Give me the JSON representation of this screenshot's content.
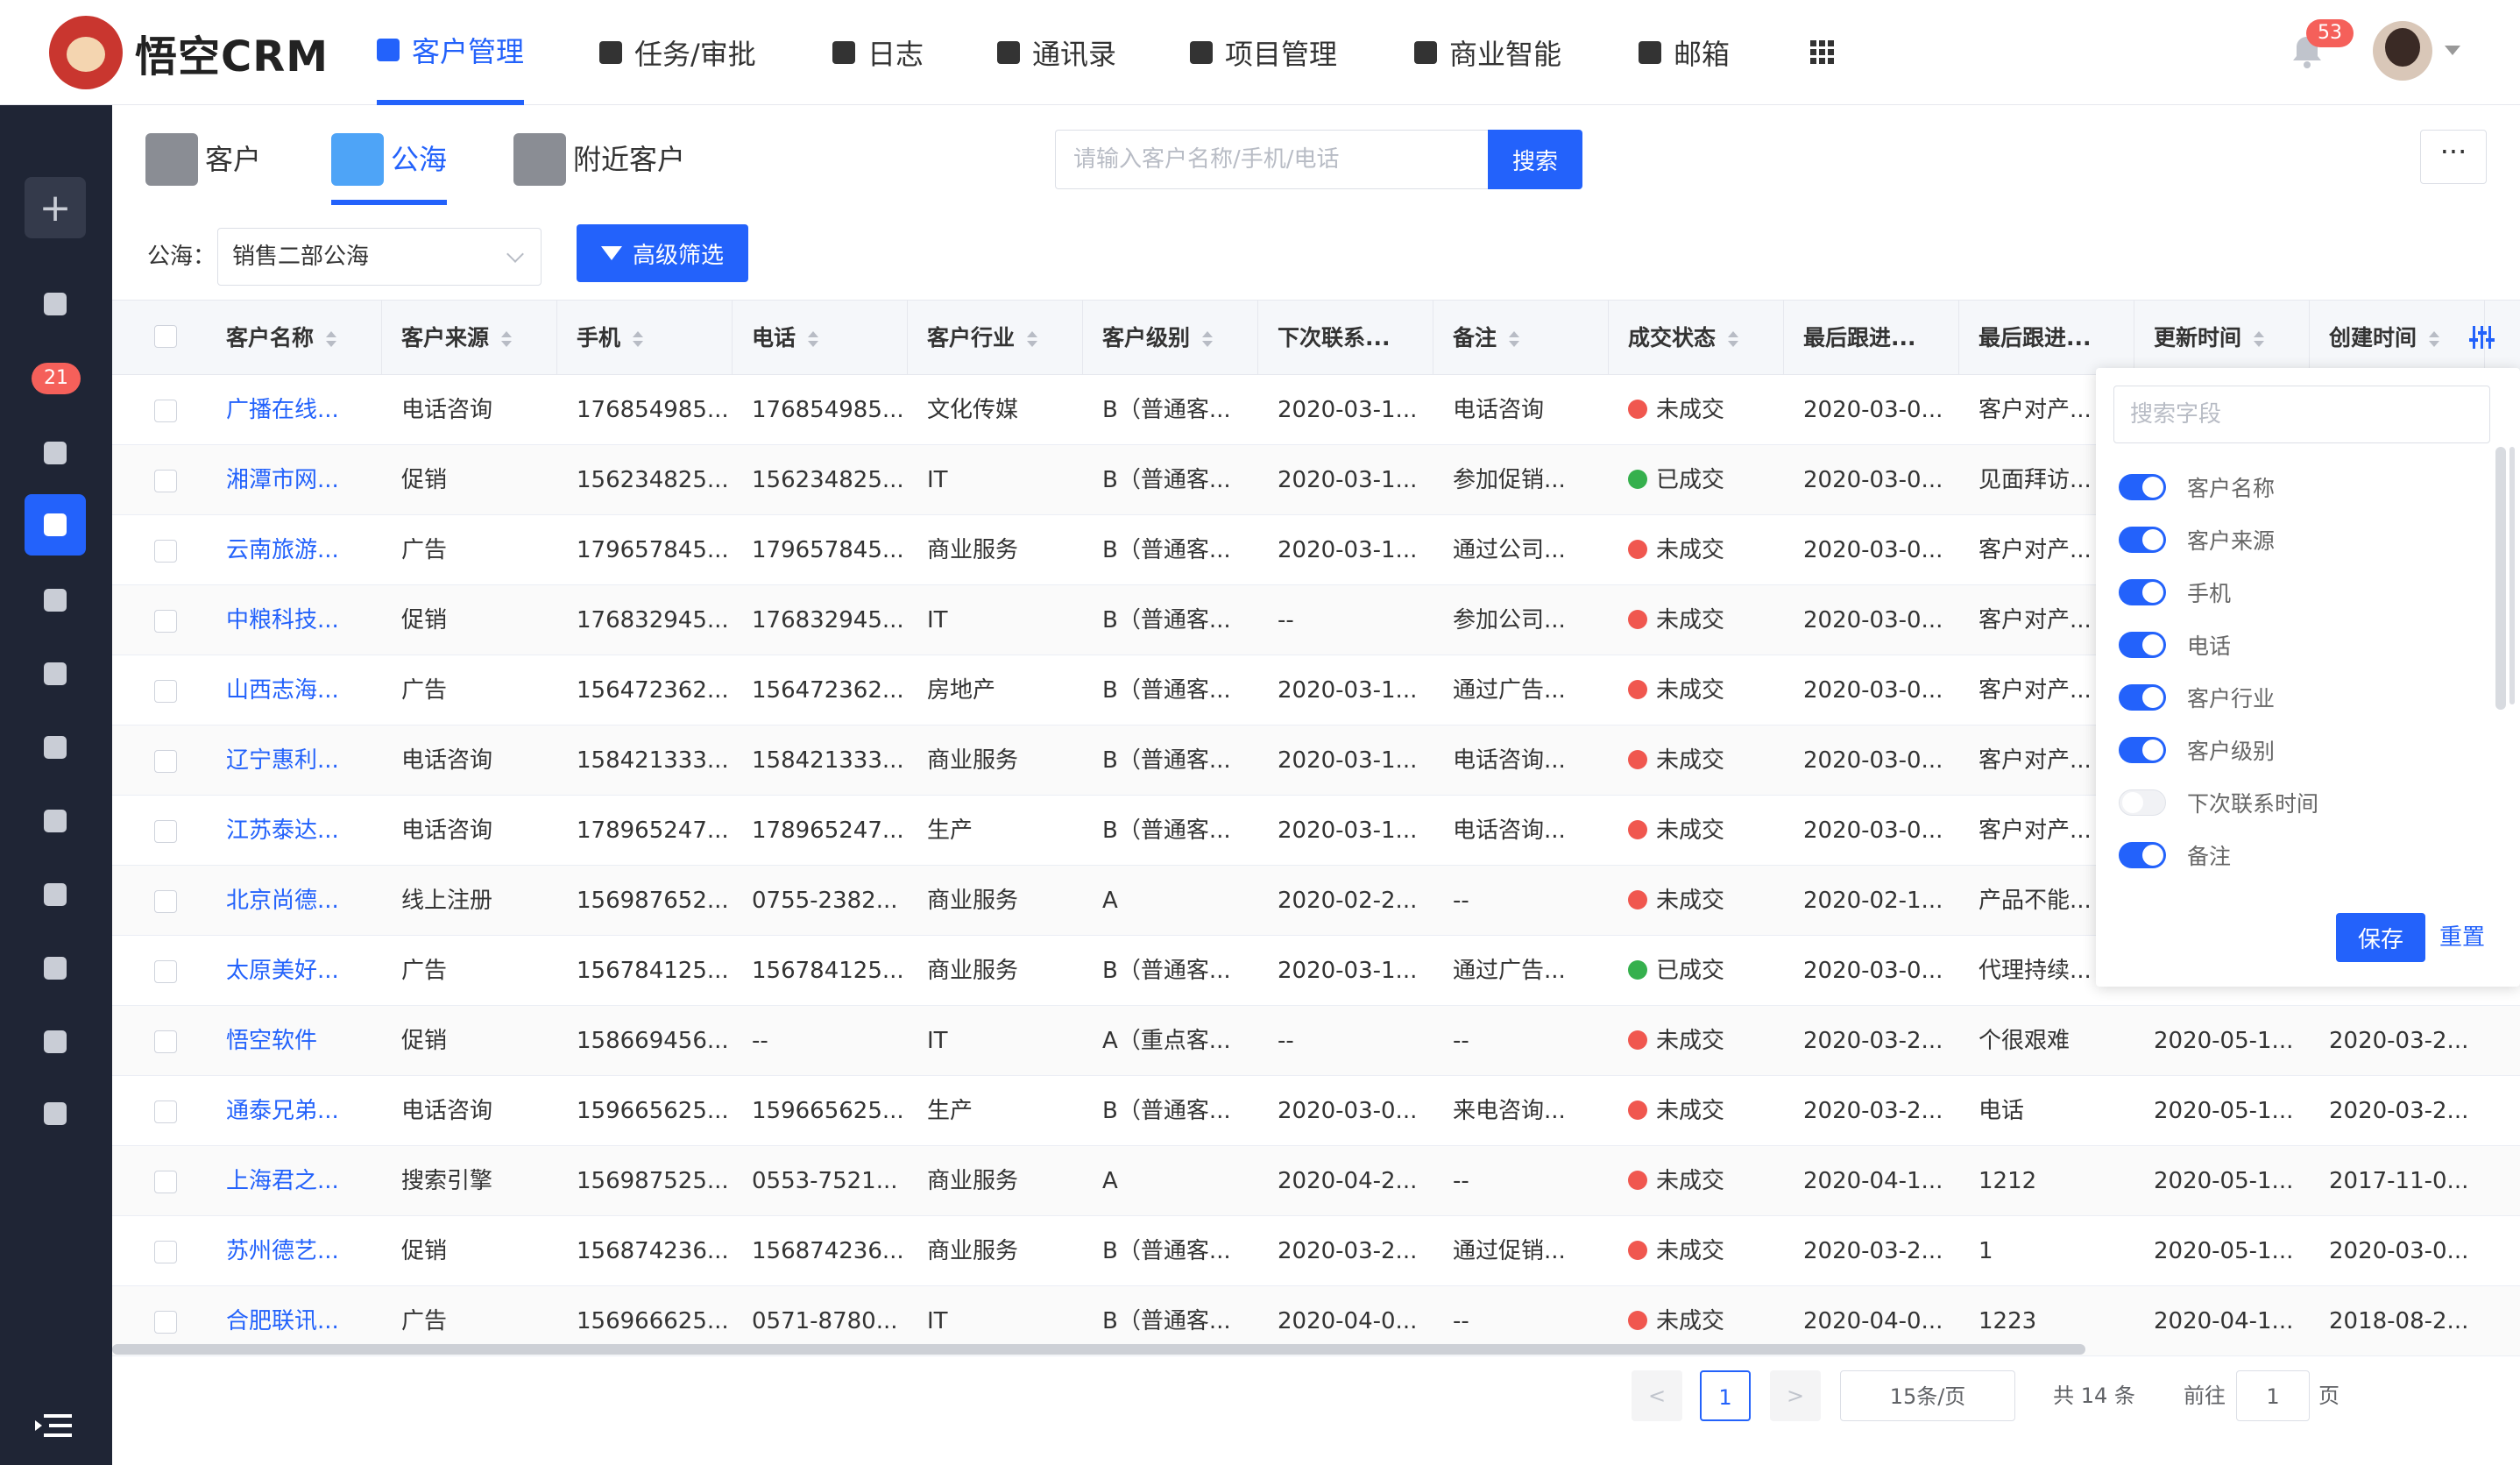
{
  "app": {
    "name": "悟空CRM"
  },
  "topnav": [
    {
      "label": "客户管理",
      "icon": "building-icon",
      "active": true
    },
    {
      "label": "任务/审批",
      "icon": "briefcase-icon",
      "active": false
    },
    {
      "label": "日志",
      "icon": "document-icon",
      "active": false
    },
    {
      "label": "通讯录",
      "icon": "phone-book-icon",
      "active": false
    },
    {
      "label": "项目管理",
      "icon": "list-icon",
      "active": false
    },
    {
      "label": "商业智能",
      "icon": "shield-check-icon",
      "active": false
    },
    {
      "label": "邮箱",
      "icon": "mail-icon",
      "active": false
    }
  ],
  "notifications": {
    "count": "53"
  },
  "sidebar": {
    "badge": "21"
  },
  "page_tabs": [
    {
      "label": "客户",
      "icon": "customer-icon",
      "active": false
    },
    {
      "label": "公海",
      "icon": "sea-icon",
      "active": true
    },
    {
      "label": "附近客户",
      "icon": "location-icon",
      "active": false
    }
  ],
  "search": {
    "placeholder": "请输入客户名称/手机/电话",
    "button": "搜索"
  },
  "more_button": "···",
  "filter": {
    "pool_label": "公海：",
    "pool_value": "销售二部公海",
    "advanced_button": "高级筛选"
  },
  "table": {
    "columns": [
      "客户名称",
      "客户来源",
      "手机",
      "电话",
      "客户行业",
      "客户级别",
      "下次联系...",
      "备注",
      "成交状态",
      "最后跟进...",
      "最后跟进...",
      "更新时间",
      "创建时间"
    ],
    "rows": [
      [
        "广播在线...",
        "电话咨询",
        "176854985...",
        "176854985...",
        "文化传媒",
        "B（普通客...",
        "2020-03-1...",
        "电话咨询",
        "未成交",
        "2020-03-0...",
        "客户对产...",
        "",
        ""
      ],
      [
        "湘潭市网...",
        "促销",
        "156234825...",
        "156234825...",
        "IT",
        "B（普通客...",
        "2020-03-1...",
        "参加促销...",
        "已成交",
        "2020-03-0...",
        "见面拜访...",
        "",
        ""
      ],
      [
        "云南旅游...",
        "广告",
        "179657845...",
        "179657845...",
        "商业服务",
        "B（普通客...",
        "2020-03-1...",
        "通过公司...",
        "未成交",
        "2020-03-0...",
        "客户对产...",
        "",
        ""
      ],
      [
        "中粮科技...",
        "促销",
        "176832945...",
        "176832945...",
        "IT",
        "B（普通客...",
        "--",
        "参加公司...",
        "未成交",
        "2020-03-0...",
        "客户对产...",
        "",
        ""
      ],
      [
        "山西志海...",
        "广告",
        "156472362...",
        "156472362...",
        "房地产",
        "B（普通客...",
        "2020-03-1...",
        "通过广告...",
        "未成交",
        "2020-03-0...",
        "客户对产...",
        "",
        ""
      ],
      [
        "辽宁惠利...",
        "电话咨询",
        "158421333...",
        "158421333...",
        "商业服务",
        "B（普通客...",
        "2020-03-1...",
        "电话咨询...",
        "未成交",
        "2020-03-0...",
        "客户对产...",
        "",
        ""
      ],
      [
        "江苏泰达...",
        "电话咨询",
        "178965247...",
        "178965247...",
        "生产",
        "B（普通客...",
        "2020-03-1...",
        "电话咨询...",
        "未成交",
        "2020-03-0...",
        "客户对产...",
        "",
        ""
      ],
      [
        "北京尚德...",
        "线上注册",
        "156987652...",
        "0755-2382...",
        "商业服务",
        "A",
        "2020-02-2...",
        "--",
        "未成交",
        "2020-02-1...",
        "产品不能...",
        "",
        ""
      ],
      [
        "太原美好...",
        "广告",
        "156784125...",
        "156784125...",
        "商业服务",
        "B（普通客...",
        "2020-03-1...",
        "通过广告...",
        "已成交",
        "2020-03-0...",
        "代理持续...",
        "",
        ""
      ],
      [
        "悟空软件",
        "促销",
        "158669456...",
        "--",
        "IT",
        "A（重点客...",
        "--",
        "--",
        "未成交",
        "2020-03-2...",
        "个很艰难",
        "2020-05-1...",
        "2020-03-2..."
      ],
      [
        "通泰兄弟...",
        "电话咨询",
        "159665625...",
        "159665625...",
        "生产",
        "B（普通客...",
        "2020-03-0...",
        "来电咨询...",
        "未成交",
        "2020-03-2...",
        "电话",
        "2020-05-1...",
        "2020-03-2..."
      ],
      [
        "上海君之...",
        "搜索引擎",
        "156987525...",
        "0553-7521...",
        "商业服务",
        "A",
        "2020-04-2...",
        "--",
        "未成交",
        "2020-04-1...",
        "1212",
        "2020-05-1...",
        "2017-11-0..."
      ],
      [
        "苏州德艺...",
        "促销",
        "156874236...",
        "156874236...",
        "商业服务",
        "B（普通客...",
        "2020-03-2...",
        "通过促销...",
        "未成交",
        "2020-03-2...",
        "1",
        "2020-05-1...",
        "2020-03-0..."
      ],
      [
        "合肥联讯...",
        "广告",
        "156966625...",
        "0571-8780...",
        "IT",
        "B（普通客...",
        "2020-04-0...",
        "--",
        "未成交",
        "2020-04-0...",
        "1223",
        "2020-04-1...",
        "2018-08-2..."
      ]
    ]
  },
  "field_popover": {
    "search_placeholder": "搜索字段",
    "fields": [
      {
        "label": "客户名称",
        "on": true
      },
      {
        "label": "客户来源",
        "on": true
      },
      {
        "label": "手机",
        "on": true
      },
      {
        "label": "电话",
        "on": true
      },
      {
        "label": "客户行业",
        "on": true
      },
      {
        "label": "客户级别",
        "on": true
      },
      {
        "label": "下次联系时间",
        "on": false
      },
      {
        "label": "备注",
        "on": true
      }
    ],
    "save": "保存",
    "reset": "重置"
  },
  "pagination": {
    "prev": "<",
    "current": "1",
    "next": ">",
    "page_size": "15条/页",
    "total": "共 14 条",
    "goto_label": "前往",
    "goto_value": "1",
    "page_label": "页"
  },
  "colors": {
    "primary": "#2362fb",
    "sidebar": "#1f2535",
    "danger": "#f0574f",
    "success": "#35b04d"
  }
}
